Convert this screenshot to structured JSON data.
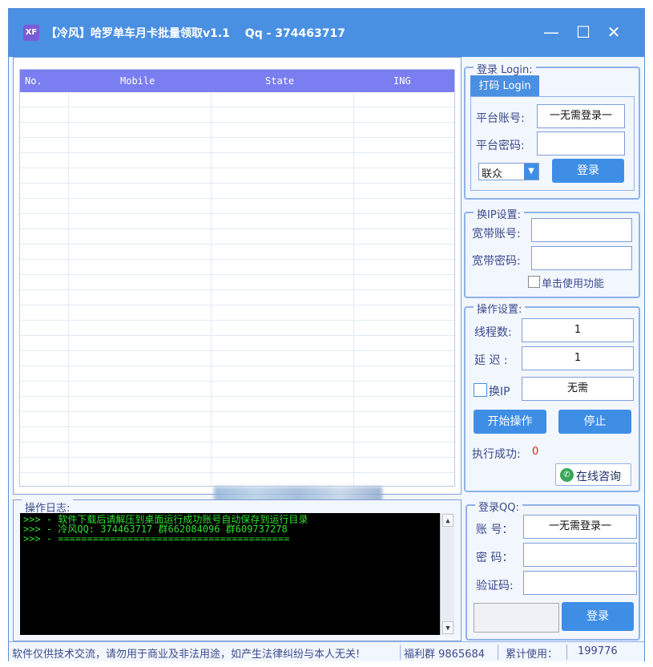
{
  "window": {
    "icon_text": "XF",
    "title": "【冷风】哈罗单车月卡批量领取v1.1　 Qq - 374463717",
    "minimize_glyph": "—",
    "maximize_glyph": "☐",
    "close_glyph": "✕"
  },
  "grid": {
    "columns": [
      "No.",
      "Mobile",
      "State",
      "ING"
    ]
  },
  "login": {
    "legend": "登录 Login:",
    "tab": "打码 Login",
    "account_label": "平台账号:",
    "account_value": "一无需登录一",
    "password_label": "平台密码:",
    "password_value": "",
    "provider_selected": "联众",
    "login_button": "登录"
  },
  "ip_settings": {
    "legend": "换IP设置:",
    "broadband_account_label": "宽带账号:",
    "broadband_password_label": "宽带密码:",
    "single_click_label": "单击使用功能"
  },
  "operation": {
    "legend": "操作设置:",
    "threads_label": "线程数:",
    "threads_value": "1",
    "delay_label": "延 迟 :",
    "delay_value": "1",
    "change_ip_label": "换IP",
    "change_ip_value": "无需",
    "start_button": "开始操作",
    "stop_button": "停止",
    "success_label": "执行成功:",
    "success_count": "0",
    "consult_button": "在线咨询"
  },
  "log": {
    "legend": "操作日志:",
    "lines": [
      ">>> - 软件下载后请解压到桌面运行成功账号自动保存到运行目录",
      ">>> - 冷风QQ: 374463717 群662084096 群609737278",
      ">>> - ========================================"
    ]
  },
  "qq_login": {
    "legend": "登录QQ:",
    "account_label": "账 号：",
    "account_value": "一无需登录一",
    "password_label": "密 码：",
    "captcha_label": "验证码:",
    "login_button": "登录"
  },
  "status": {
    "disclaimer": "软件仅供技术交流，请勿用于商业及非法用途，如产生法律纠纷与本人无关!",
    "group": "福利群 9865684",
    "total_label": "累计使用：",
    "total_value": "199776"
  },
  "colors": {
    "titlebar": "#4a90e2",
    "grid_header": "#7b7ef0",
    "button": "#3f8ee6",
    "log_text": "#2ee12e",
    "success_count": "#e02020"
  }
}
